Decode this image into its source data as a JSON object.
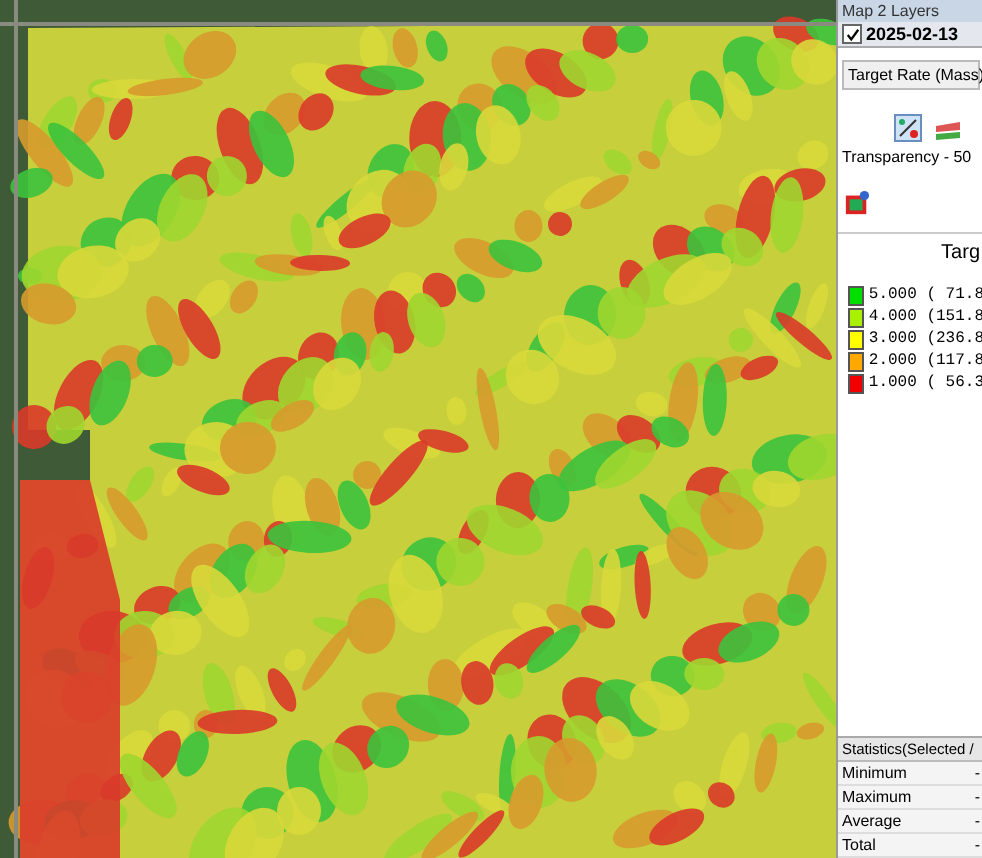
{
  "panel": {
    "title": "Map 2 Layers",
    "layer": {
      "checked": true,
      "date": "2025-02-13"
    },
    "attribute": "Target Rate (Mass)",
    "transparency": "Transparency - 50",
    "legend": {
      "title": "Targ",
      "items": [
        {
          "label": "5.000 ( 71.8",
          "color": "#00e000"
        },
        {
          "label": "4.000 (151.8",
          "color": "#a8f000"
        },
        {
          "label": "3.000 (236.8",
          "color": "#ffff00"
        },
        {
          "label": "2.000 (117.8",
          "color": "#ffa800"
        },
        {
          "label": "1.000 ( 56.3",
          "color": "#f00000"
        }
      ]
    },
    "statistics": {
      "title": "Statistics(Selected /",
      "rows": [
        {
          "label": "Minimum",
          "value": "-"
        },
        {
          "label": "Maximum",
          "value": "-"
        },
        {
          "label": "Average",
          "value": "-"
        },
        {
          "label": "Total",
          "value": "-"
        }
      ]
    }
  }
}
